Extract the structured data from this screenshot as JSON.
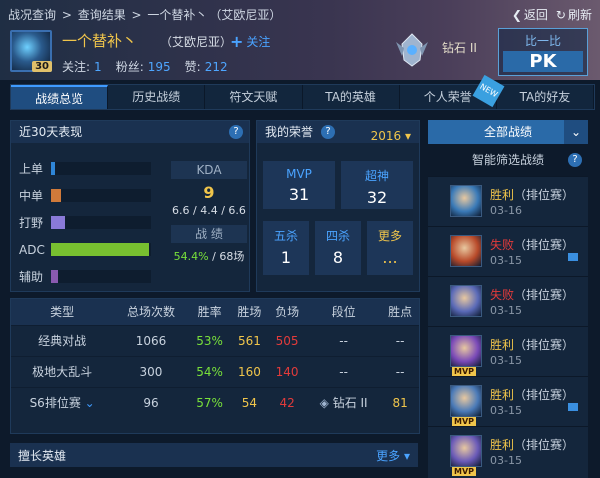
{
  "header": {
    "breadcrumb": [
      "战况查询",
      " > ",
      "查询结果",
      " > ",
      "一个替补丶",
      "（艾欧尼亚）"
    ],
    "back_label": "返回",
    "refresh_label": "刷新",
    "avatar_level": "30",
    "username": "一个替补丶",
    "server": "（艾欧尼亚）",
    "follow_label": "关注",
    "stats": {
      "following_label": "关注:",
      "following": "1",
      "fans_label": "粉丝:",
      "fans": "195",
      "likes_label": "赞:",
      "likes": "212"
    },
    "rank_name": "钻石 II",
    "compare_label": "比一比",
    "pk_label": "PK"
  },
  "tabs": [
    "战绩总览",
    "历史战绩",
    "符文天赋",
    "TA的英雄",
    "个人荣誉",
    "TA的好友"
  ],
  "tab_new_badge": "NEW",
  "recent": {
    "title": "近30天表现",
    "roles": [
      {
        "name": "上单",
        "value": 0.04,
        "color": "#2f86d8"
      },
      {
        "name": "中单",
        "value": 0.1,
        "color": "#d07a3a"
      },
      {
        "name": "打野",
        "value": 0.14,
        "color": "#8a7ad8"
      },
      {
        "name": "ADC",
        "value": 0.98,
        "color": "#78c030"
      },
      {
        "name": "辅助",
        "value": 0.07,
        "color": "#8a5ab0"
      }
    ],
    "kda_label": "KDA",
    "kda_value": "9",
    "kda_detail": "6.6 / 4.4 / 6.6",
    "score_label": "战 绩",
    "winrate": "54.4%",
    "games": "/ 68场"
  },
  "honors": {
    "title": "我的荣誉",
    "year": "2016",
    "items": [
      {
        "label": "MVP",
        "value": "31"
      },
      {
        "label": "超神",
        "value": "32"
      },
      {
        "label": "五杀",
        "value": "1"
      },
      {
        "label": "四杀",
        "value": "8"
      },
      {
        "label": "更多",
        "value": "..."
      }
    ]
  },
  "table": {
    "headers": [
      "类型",
      "总场次数",
      "胜率",
      "胜场",
      "负场",
      "段位",
      "胜点"
    ],
    "rows": [
      {
        "type": "经典对战",
        "total": "1066",
        "rate": "53%",
        "win": "561",
        "lose": "505",
        "rank": "--",
        "points": "--"
      },
      {
        "type": "极地大乱斗",
        "total": "300",
        "rate": "54%",
        "win": "160",
        "lose": "140",
        "rank": "--",
        "points": "--"
      },
      {
        "type": "S6排位赛",
        "total": "96",
        "rate": "57%",
        "win": "54",
        "lose": "42",
        "rank": "钻石 II",
        "points": "81"
      }
    ]
  },
  "bottom": {
    "title": "擅长英雄",
    "more": "更多"
  },
  "right": {
    "all_label": "全部战绩",
    "filter_label": "智能筛选战绩",
    "matches": [
      {
        "result": "胜利",
        "mode": "（排位赛）",
        "date": "03-16",
        "win": true,
        "mvp": false,
        "video": false
      },
      {
        "result": "失败",
        "mode": "（排位赛）",
        "date": "03-15",
        "win": false,
        "mvp": false,
        "video": true
      },
      {
        "result": "失败",
        "mode": "（排位赛）",
        "date": "03-15",
        "win": false,
        "mvp": false,
        "video": false
      },
      {
        "result": "胜利",
        "mode": "（排位赛）",
        "date": "03-15",
        "win": true,
        "mvp": true,
        "video": false
      },
      {
        "result": "胜利",
        "mode": "（排位赛）",
        "date": "03-15",
        "win": true,
        "mvp": true,
        "video": true
      },
      {
        "result": "胜利",
        "mode": "（排位赛）",
        "date": "03-15",
        "win": true,
        "mvp": true,
        "video": false
      }
    ]
  }
}
